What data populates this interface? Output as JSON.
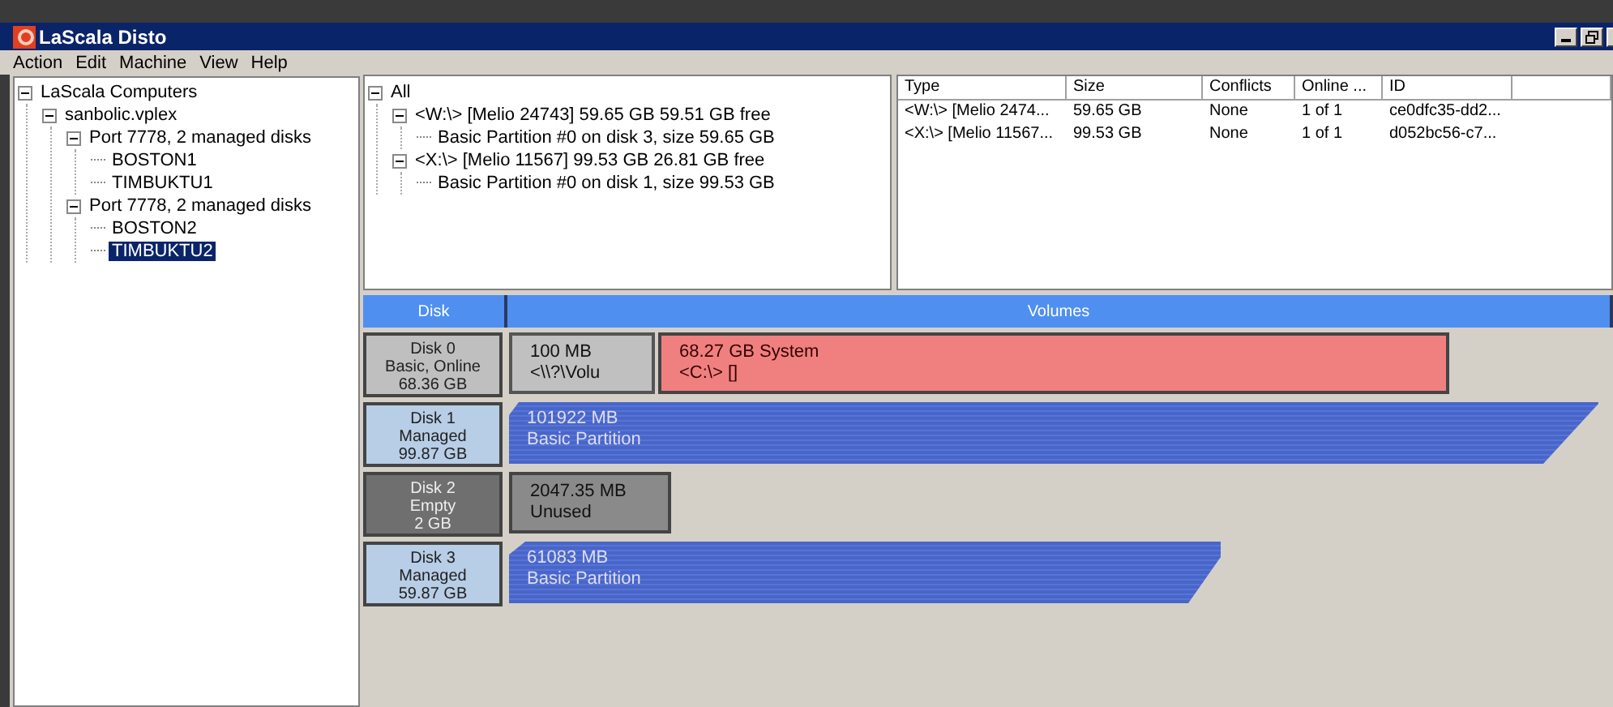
{
  "window": {
    "title": "LaScala Disto"
  },
  "menu": [
    "Action",
    "Edit",
    "Machine",
    "View",
    "Help"
  ],
  "computer_tree": [
    {
      "label": "LaScala Computers",
      "expanded": true,
      "selected": false,
      "children": [
        {
          "label": "sanbolic.vplex",
          "expanded": true,
          "selected": false,
          "children": [
            {
              "label": "Port 7778, 2 managed disks",
              "expanded": true,
              "selected": false,
              "children": [
                {
                  "label": "BOSTON1",
                  "selected": false
                },
                {
                  "label": "TIMBUKTU1",
                  "selected": false
                }
              ]
            },
            {
              "label": "Port 7778, 2 managed disks",
              "expanded": true,
              "selected": false,
              "children": [
                {
                  "label": "BOSTON2",
                  "selected": false
                },
                {
                  "label": "TIMBUKTU2",
                  "selected": true
                }
              ]
            }
          ]
        }
      ]
    }
  ],
  "volume_tree": [
    {
      "label": "All",
      "expanded": true,
      "selected": false,
      "children": [
        {
          "label": "<W:\\> [Melio 24743] 59.65 GB 59.51 GB free",
          "expanded": true,
          "selected": false,
          "children": [
            {
              "label": "Basic Partition #0 on disk 3, size 59.65 GB",
              "selected": false
            }
          ]
        },
        {
          "label": "<X:\\> [Melio 11567] 99.53 GB 26.81 GB free",
          "expanded": true,
          "selected": false,
          "children": [
            {
              "label": "Basic Partition #0 on disk 1, size 99.53 GB",
              "selected": false
            }
          ]
        }
      ]
    }
  ],
  "volume_table": {
    "columns": [
      "Type",
      "Size",
      "Conflicts",
      "Online ...",
      "ID"
    ],
    "rows": [
      [
        "<W:\\> [Melio 2474...",
        "59.65 GB",
        "None",
        "1 of 1",
        "ce0dfc35-dd2..."
      ],
      [
        "<X:\\> [Melio 11567...",
        "99.53 GB",
        "None",
        "1 of 1",
        "d052bc56-c7..."
      ]
    ]
  },
  "disk_map": {
    "columns": [
      "Disk",
      "Volumes"
    ],
    "disks": [
      {
        "kind": "basic",
        "lines": [
          "Disk 0",
          "Basic, Online",
          "68.36 GB"
        ],
        "volumes": [
          {
            "kind": "small",
            "size": "100 MB",
            "label": "<\\\\?\\Volu"
          },
          {
            "kind": "system",
            "size": "68.27 GB System",
            "label": "<C:\\> []"
          }
        ]
      },
      {
        "kind": "managed",
        "lines": [
          "Disk 1",
          "Managed",
          "99.87 GB"
        ],
        "volumes": [
          {
            "kind": "partition",
            "size": "101922 MB",
            "label": "Basic Partition"
          }
        ]
      },
      {
        "kind": "empty",
        "lines": [
          "Disk 2",
          "Empty",
          "2 GB"
        ],
        "volumes": [
          {
            "kind": "unused",
            "size": "2047.35 MB",
            "label": "Unused"
          }
        ]
      },
      {
        "kind": "managed",
        "lines": [
          "Disk 3",
          "Managed",
          "59.87 GB"
        ],
        "volumes": [
          {
            "kind": "partition",
            "size": "61083 MB",
            "label": "Basic Partition"
          }
        ]
      }
    ]
  }
}
